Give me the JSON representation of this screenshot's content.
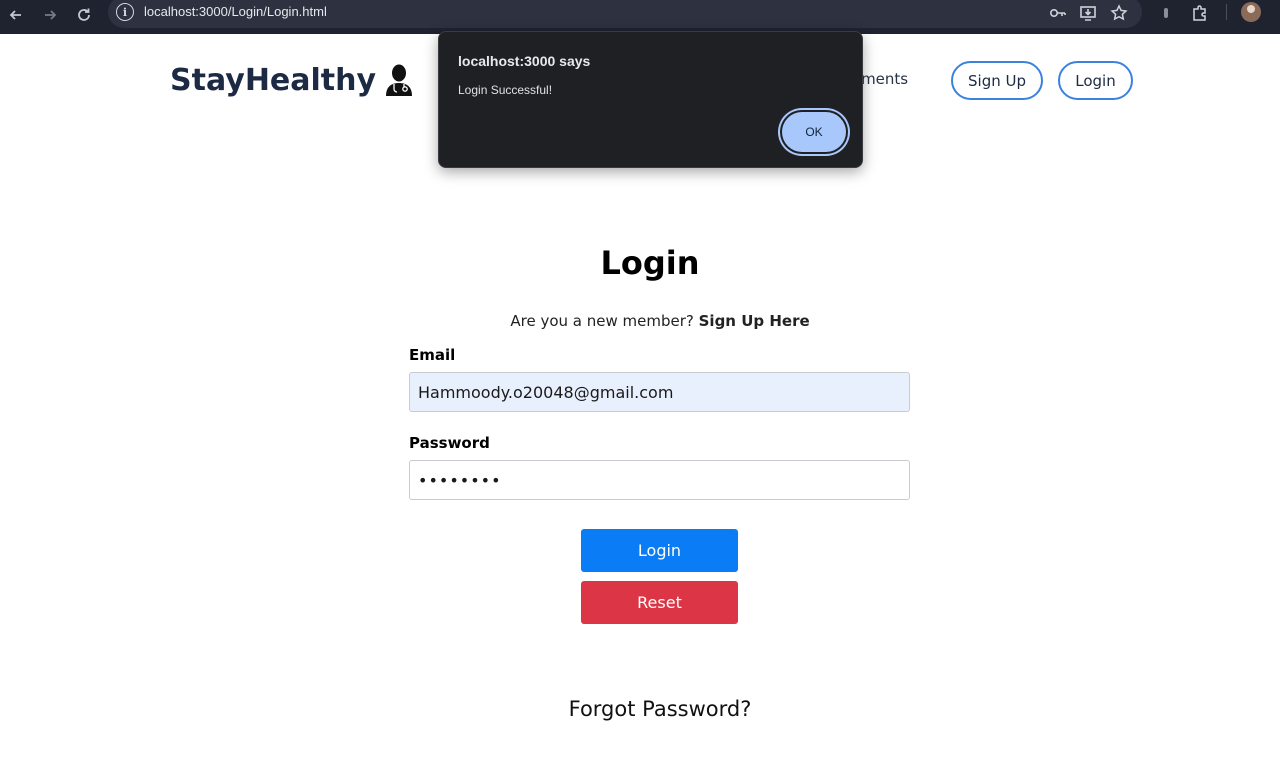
{
  "browser": {
    "url": "localhost:3000/Login/Login.html"
  },
  "header": {
    "brand": "StayHealthy",
    "nav_partial": "atments",
    "signup_label": "Sign Up",
    "login_label": "Login"
  },
  "alert": {
    "title": "localhost:3000 says",
    "message": "Login Successful!",
    "ok_label": "OK"
  },
  "form": {
    "title": "Login",
    "member_prompt": "Are you a new member?",
    "signup_link": "Sign Up Here",
    "email_label": "Email",
    "email_value": "Hammoody.o20048@gmail.com",
    "password_label": "Password",
    "password_value": "••••••••",
    "login_button": "Login",
    "reset_button": "Reset",
    "forgot_link": "Forgot Password?"
  },
  "colors": {
    "brand": "#1c2a44",
    "primary": "#0a7cf6",
    "danger": "#dc3545",
    "outline": "#3b82dd",
    "autofill": "#e8f0fe"
  }
}
